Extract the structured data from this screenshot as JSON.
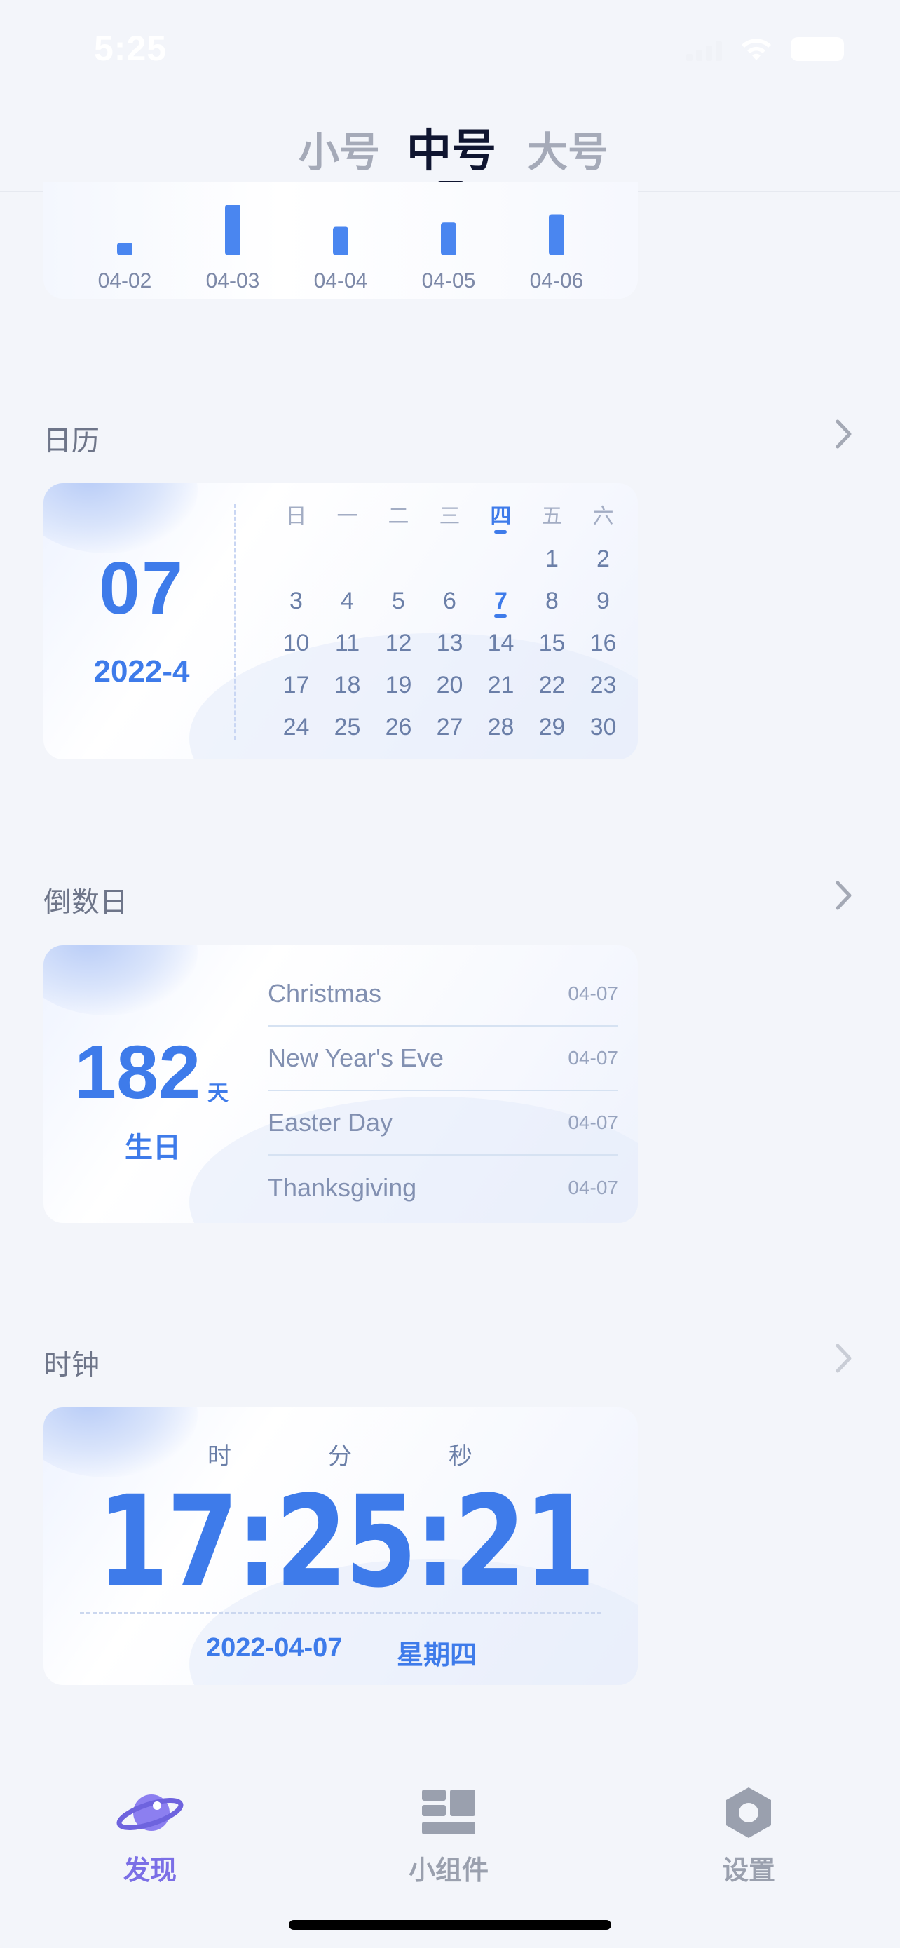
{
  "status_bar": {
    "time": "5:25"
  },
  "size_tabs": {
    "small": "小号",
    "medium": "中号",
    "large": "大号",
    "selected": "中号"
  },
  "bar_chart": {
    "chart_data": {
      "type": "bar",
      "categories": [
        "04-02",
        "04-03",
        "04-04",
        "04-05",
        "04-06"
      ],
      "values": [
        20,
        80,
        45,
        52,
        65
      ],
      "title": "",
      "xlabel": "",
      "ylabel": "",
      "ylim": [
        0,
        100
      ],
      "color": "#4A86F0",
      "grid": false
    }
  },
  "calendar": {
    "title": "日历",
    "day": "07",
    "month": "2022-4",
    "weekdays": [
      "日",
      "一",
      "二",
      "三",
      "四",
      "五",
      "六"
    ],
    "today_weekday_index": 4,
    "weeks": [
      [
        "",
        "",
        "",
        "",
        "",
        "1",
        "2"
      ],
      [
        "3",
        "4",
        "5",
        "6",
        "7",
        "8",
        "9"
      ],
      [
        "10",
        "11",
        "12",
        "13",
        "14",
        "15",
        "16"
      ],
      [
        "17",
        "18",
        "19",
        "20",
        "21",
        "22",
        "23"
      ],
      [
        "24",
        "25",
        "26",
        "27",
        "28",
        "29",
        "30"
      ]
    ],
    "today": "7"
  },
  "countdown": {
    "title": "倒数日",
    "days": "182",
    "unit": "天",
    "label": "生日",
    "items": [
      {
        "name": "Christmas",
        "date": "04-07"
      },
      {
        "name": "New Year's Eve",
        "date": "04-07"
      },
      {
        "name": "Easter Day",
        "date": "04-07"
      },
      {
        "name": "Thanksgiving",
        "date": "04-07"
      }
    ]
  },
  "clock": {
    "title": "时钟",
    "hour_label": "时",
    "minute_label": "分",
    "second_label": "秒",
    "time": "17:25:21",
    "date": "2022-04-07",
    "weekday": "星期四"
  },
  "tab_bar": {
    "discover": "发现",
    "widgets": "小组件",
    "settings": "设置",
    "active": "发现"
  },
  "colors": {
    "accent": "#3E7BEA",
    "tab_active": "#7B6FE6",
    "tab_inactive": "#9AA0AE",
    "background": "#F3F5FA"
  }
}
